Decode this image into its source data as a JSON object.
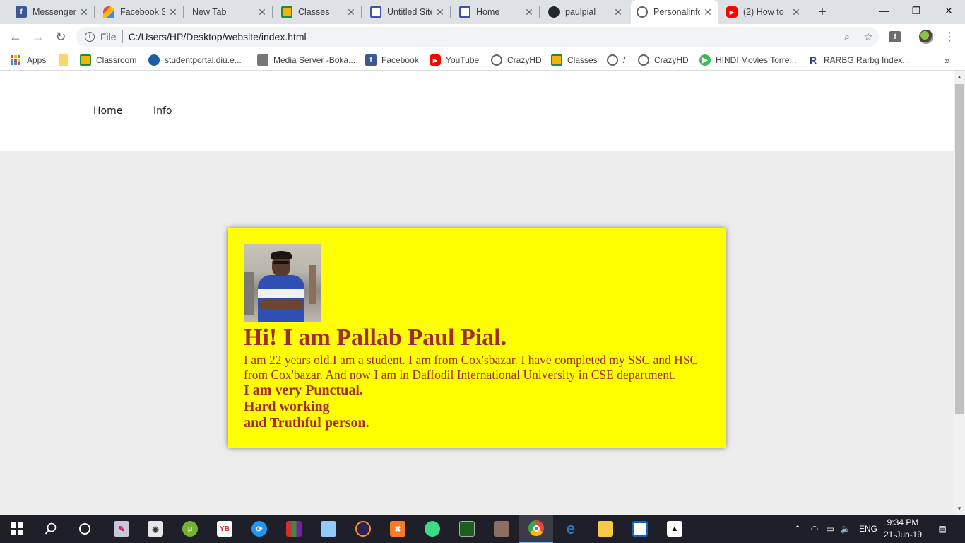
{
  "browser": {
    "tabs": [
      {
        "title": "Messenger",
        "icon": "facebook-icon",
        "active": false
      },
      {
        "title": "Facebook S",
        "icon": "facebook-sticker-icon",
        "active": false
      },
      {
        "title": "New Tab",
        "icon": "",
        "active": false
      },
      {
        "title": "Classes",
        "icon": "google-classroom-icon",
        "active": false
      },
      {
        "title": "Untitled Site",
        "icon": "google-sites-icon",
        "active": false
      },
      {
        "title": "Home",
        "icon": "google-sites-icon",
        "active": false
      },
      {
        "title": "paulpial",
        "icon": "github-icon",
        "active": false
      },
      {
        "title": "Personalinfo",
        "icon": "globe-icon",
        "active": true
      },
      {
        "title": "(2) How to",
        "icon": "youtube-icon",
        "active": false
      }
    ],
    "omnibox": {
      "scheme": "File",
      "url": "C:/Users/HP/Desktop/website/index.html"
    },
    "bookmarks": [
      {
        "label": "Apps",
        "icon": "apps-grid-icon"
      },
      {
        "label": "",
        "icon": "folder-icon"
      },
      {
        "label": "Classroom",
        "icon": "google-classroom-icon"
      },
      {
        "label": "studentportal.diu.e...",
        "icon": "student-portal-icon"
      },
      {
        "label": "Media Server -Boka...",
        "icon": "media-server-icon"
      },
      {
        "label": "Facebook",
        "icon": "facebook-icon"
      },
      {
        "label": "YouTube",
        "icon": "youtube-icon"
      },
      {
        "label": "CrazyHD",
        "icon": "globe-icon"
      },
      {
        "label": "Classes",
        "icon": "google-classroom-icon"
      },
      {
        "label": "/",
        "icon": "globe-icon"
      },
      {
        "label": "CrazyHD",
        "icon": "globe-icon"
      },
      {
        "label": "HINDI Movies Torre...",
        "icon": "play-icon"
      },
      {
        "label": "RARBG Rarbg Index...",
        "icon": "rarbg-icon"
      }
    ]
  },
  "site": {
    "nav": [
      "Home",
      "Info"
    ],
    "card": {
      "heading": "Hi! I am Pallab Paul Pial.",
      "bio": "I am 22 years old.I am a student. I am from Cox'sbazar. I have completed my SSC and HSC from Cox'bazar. And now I am in Daffodil International University in CSE department.",
      "traits": [
        "I am very Punctual.",
        "Hard working",
        "and Truthful person."
      ]
    },
    "colors": {
      "card_bg": "#ffff00",
      "card_text": "#a52a2a",
      "page_bg": "#ededed"
    }
  },
  "taskbar": {
    "apps": [
      "start-icon",
      "search-icon",
      "cortana-icon",
      "paint-icon",
      "camera-icon",
      "utorrent-icon",
      "yb-icon",
      "sync-icon",
      "winrar-icon",
      "virtualbox-icon",
      "eclipse-icon",
      "xampp-icon",
      "android-studio-icon",
      "arduino-icon",
      "package-icon",
      "chrome-icon",
      "edge-icon",
      "file-explorer-icon",
      "code-editor-icon",
      "photos-icon"
    ],
    "language": "ENG",
    "time": "9:34 PM",
    "date": "21-Jun-19"
  }
}
